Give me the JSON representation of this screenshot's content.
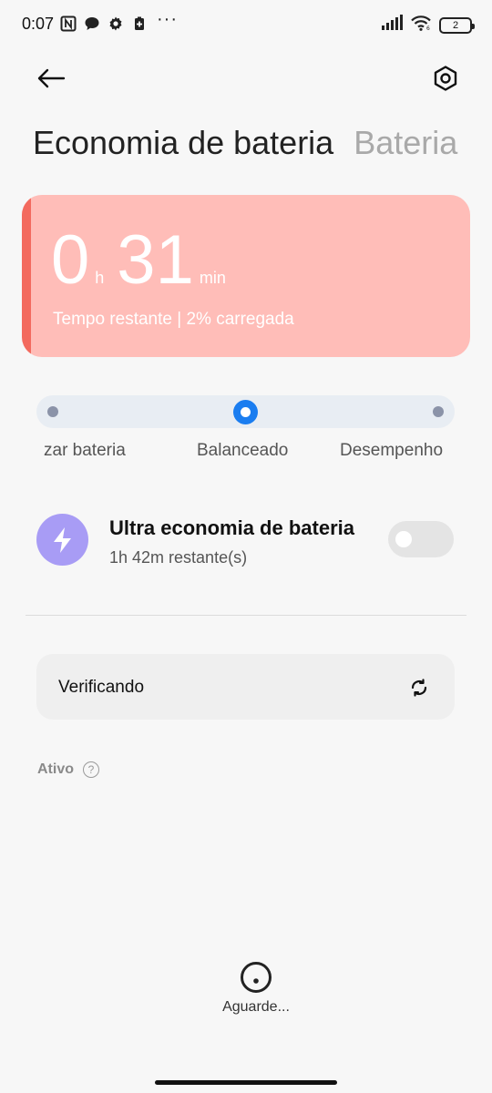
{
  "status_bar": {
    "time": "0:07",
    "more": "···",
    "battery_level": "2",
    "left_icons": [
      "nfc-icon",
      "chat-bubble-icon",
      "gear-icon",
      "battery-saver-icon"
    ],
    "right_icons": [
      "signal-icon",
      "wifi-icon",
      "battery-icon"
    ]
  },
  "header": {
    "tabs": [
      {
        "label": "Economia de bateria",
        "active": true
      },
      {
        "label": "Bateria",
        "active": false
      }
    ]
  },
  "battery_card": {
    "hours": "0",
    "hours_unit": "h",
    "minutes": "31",
    "minutes_unit": "min",
    "subtitle": "Tempo restante | 2% carregada",
    "accent_color": "#f36a5e",
    "background_color": "#ffbdb8"
  },
  "mode_slider": {
    "options": [
      "zar bateria",
      "Balanceado",
      "Desempenho"
    ],
    "selected": "Balanceado",
    "accent_color": "#1a7df0"
  },
  "ultra_saver": {
    "title": "Ultra economia de bateria",
    "subtitle": "1h 42m restante(s)",
    "enabled": false,
    "icon": "lightning-icon"
  },
  "check": {
    "label": "Verificando",
    "icon": "refresh-icon"
  },
  "section": {
    "active_label": "Ativo",
    "help": "?"
  },
  "footer": {
    "wait_label": "Aguarde..."
  }
}
